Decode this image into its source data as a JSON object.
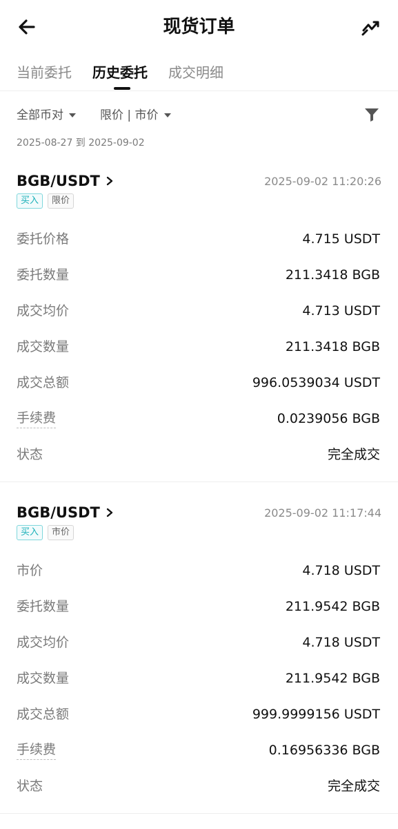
{
  "header": {
    "title": "现货订单"
  },
  "tabs": [
    {
      "label": "当前委托"
    },
    {
      "label": "历史委托"
    },
    {
      "label": "成交明细"
    }
  ],
  "active_tab": "历史委托",
  "filters": {
    "pair_filter": "全部币对",
    "type_filter": "限价 | 市价",
    "date_range": "2025-08-27 到 2025-09-02"
  },
  "orders": [
    {
      "pair": "BGB/USDT",
      "time": "2025-09-02 11:20:26",
      "side": "买入",
      "type": "限价",
      "rows": [
        {
          "label": "委托价格",
          "value": "4.715 USDT"
        },
        {
          "label": "委托数量",
          "value": "211.3418 BGB"
        },
        {
          "label": "成交均价",
          "value": "4.713 USDT"
        },
        {
          "label": "成交数量",
          "value": "211.3418 BGB"
        },
        {
          "label": "成交总额",
          "value": "996.0539034 USDT"
        },
        {
          "label": "手续费",
          "value": "0.0239056 BGB"
        },
        {
          "label": "状态",
          "value": "完全成交"
        }
      ]
    },
    {
      "pair": "BGB/USDT",
      "time": "2025-09-02 11:17:44",
      "side": "买入",
      "type": "市价",
      "rows": [
        {
          "label": "市价",
          "value": "4.718 USDT"
        },
        {
          "label": "委托数量",
          "value": "211.9542 BGB"
        },
        {
          "label": "成交均价",
          "value": "4.718 USDT"
        },
        {
          "label": "成交数量",
          "value": "211.9542 BGB"
        },
        {
          "label": "成交总额",
          "value": "999.9999156 USDT"
        },
        {
          "label": "手续费",
          "value": "0.16956336 BGB"
        },
        {
          "label": "状态",
          "value": "完全成交"
        }
      ]
    }
  ],
  "icons": {
    "back": "arrow-left-icon",
    "chart": "trend-chart-icon",
    "filter": "funnel-icon",
    "pair_chevron": "chevron-right-icon"
  },
  "colors": {
    "buy_tag": "#1ab0b8",
    "text_primary": "#111111",
    "text_secondary": "#7a7a7a"
  }
}
